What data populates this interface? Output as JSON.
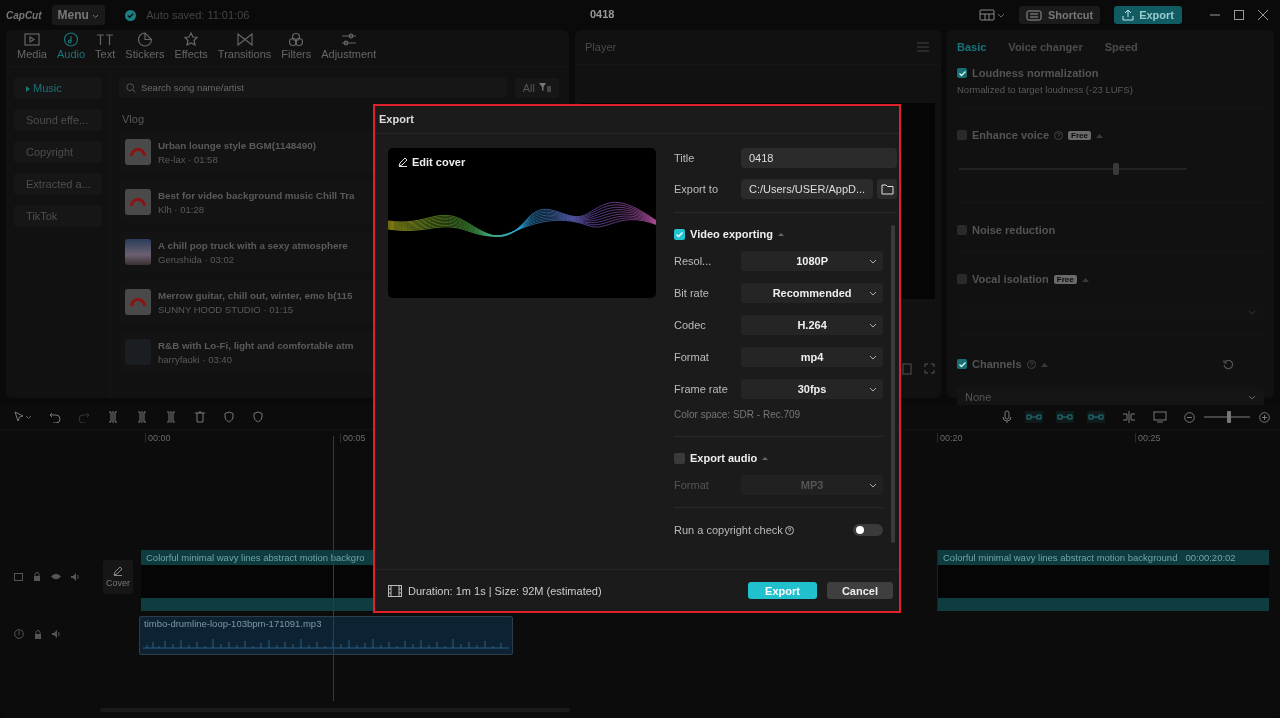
{
  "app": {
    "logo": "CapCut",
    "menu": "Menu",
    "autosave": "Auto saved: 11:01:06",
    "project_title": "0418",
    "shortcut": "Shortcut",
    "export": "Export"
  },
  "library": {
    "tabs": [
      {
        "label": "Media",
        "selected": false
      },
      {
        "label": "Audio",
        "selected": true
      },
      {
        "label": "Text",
        "selected": false
      },
      {
        "label": "Stickers",
        "selected": false
      },
      {
        "label": "Effects",
        "selected": false
      },
      {
        "label": "Transitions",
        "selected": false
      },
      {
        "label": "Filters",
        "selected": false
      },
      {
        "label": "Adjustment",
        "selected": false
      }
    ],
    "sidebar": [
      {
        "label": "Music",
        "selected": true
      },
      {
        "label": "Sound effe...",
        "selected": false
      },
      {
        "label": "Copyright",
        "selected": false
      },
      {
        "label": "Extracted a...",
        "selected": false
      },
      {
        "label": "TikTok",
        "selected": false
      }
    ],
    "search": {
      "placeholder": "Search song name/artist"
    },
    "filter": "All",
    "section": "Vlog",
    "tracks": [
      {
        "title": "Urban lounge style BGM(1148490)",
        "meta": "Re-lax · 01:58",
        "kind": "logo"
      },
      {
        "title": "Best for video background music Chill Tra",
        "meta": "Klh · 01:28",
        "kind": "logo"
      },
      {
        "title": "A chill pop truck with a sexy atmosphere",
        "meta": "Gerushida · 03:02",
        "kind": "sky"
      },
      {
        "title": "Merrow guitar, chill out, winter, emo b(115",
        "meta": "SUNNY HOOD STUDIO · 01:15",
        "kind": "logo"
      },
      {
        "title": "R&B with Lo-Fi, light and comfortable atm",
        "meta": "harryfaoki · 03:40",
        "kind": "dark"
      }
    ]
  },
  "player": {
    "title": "Player"
  },
  "properties": {
    "tabs": [
      {
        "label": "Basic",
        "selected": true
      },
      {
        "label": "Voice changer",
        "selected": false
      },
      {
        "label": "Speed",
        "selected": false
      }
    ],
    "loudness": {
      "label": "Loudness normalization",
      "checked": true,
      "note": "Normalized to target loudness (-23 LUFS)"
    },
    "options": [
      {
        "kind": "slider",
        "label": "Enhance voice",
        "checked": false,
        "help": true,
        "badge": "Free",
        "level": 0.69
      },
      {
        "kind": "plain",
        "label": "Noise reduction",
        "checked": false,
        "help": false
      },
      {
        "kind": "select",
        "label": "Vocal isolation",
        "checked": false,
        "help": false,
        "badge": "Free"
      },
      {
        "kind": "channels",
        "label": "Channels",
        "checked": true,
        "help": true,
        "value": "None"
      }
    ]
  },
  "timeline": {
    "ruler": [
      "00:00",
      "00:05",
      "00:20",
      "00:25"
    ],
    "zoom": {
      "level": 0.55
    },
    "cover": "Cover",
    "video_clip": {
      "label_left": "Colorful minimal wavy lines abstract motion backgro",
      "label_right": "Colorful minimal wavy lines abstract motion background",
      "duration": "00:00:20:02"
    },
    "audio_clip": {
      "label": "timbo-drumline-loop-103bpm-171091.mp3"
    }
  },
  "export_dialog": {
    "title": "Export",
    "edit_cover": "Edit cover",
    "fields": [
      {
        "label": "Title",
        "value": "0418"
      },
      {
        "label": "Export to",
        "value": "C:/Users/USER/AppD..."
      }
    ],
    "video": {
      "label": "Video exporting",
      "checked": true,
      "settings": [
        {
          "label": "Resol...",
          "value": "1080P"
        },
        {
          "label": "Bit rate",
          "value": "Recommended"
        },
        {
          "label": "Codec",
          "value": "H.264"
        },
        {
          "label": "Format",
          "value": "mp4"
        },
        {
          "label": "Frame rate",
          "value": "30fps"
        }
      ],
      "color_space": "Color space: SDR - Rec.709"
    },
    "audio": {
      "label": "Export audio",
      "checked": false,
      "settings": [
        {
          "label": "Format",
          "value": "MP3"
        }
      ]
    },
    "copyright": {
      "label": "Run a copyright check",
      "on": false
    },
    "summary": "Duration: 1m 1s | Size: 92M (estimated)",
    "buttons": [
      {
        "label": "Export",
        "kind": "primary"
      },
      {
        "label": "Cancel",
        "kind": "secondary"
      }
    ]
  }
}
